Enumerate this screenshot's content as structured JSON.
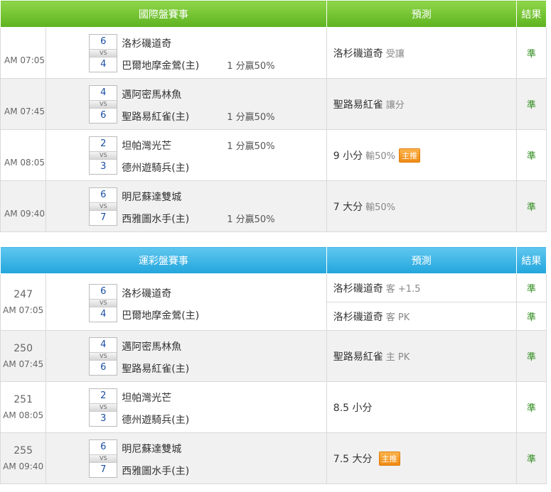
{
  "intl": {
    "header": {
      "match": "國際盤賽事",
      "pred": "預測",
      "res": "結果"
    },
    "rows": [
      {
        "time": "AM 07:05",
        "away": "洛杉磯道奇",
        "away_score": "6",
        "home": "巴爾地摩金鶯(主)",
        "home_score": "4",
        "vs": "VS",
        "pct_home": "1 分贏50%",
        "pct_away": "",
        "pred": "洛杉磯道奇",
        "pred_note": "受讓",
        "badge": "",
        "result": "準"
      },
      {
        "time": "AM 07:45",
        "away": "邁阿密馬林魚",
        "away_score": "4",
        "home": "聖路易紅雀(主)",
        "home_score": "6",
        "vs": "VS",
        "pct_home": "1 分贏50%",
        "pct_away": "",
        "pred": "聖路易紅雀",
        "pred_note": "讓分",
        "badge": "",
        "result": "準"
      },
      {
        "time": "AM 08:05",
        "away": "坦帕灣光芒",
        "away_score": "2",
        "home": "德州遊騎兵(主)",
        "home_score": "3",
        "vs": "VS",
        "pct_home": "",
        "pct_away": "1 分贏50%",
        "pred": "9 小分",
        "pred_note": "輸50%",
        "badge": "主推",
        "result": "準"
      },
      {
        "time": "AM 09:40",
        "away": "明尼蘇達雙城",
        "away_score": "6",
        "home": "西雅圖水手(主)",
        "home_score": "7",
        "vs": "VS",
        "pct_home": "1 分贏50%",
        "pct_away": "",
        "pred": "7 大分",
        "pred_note": "輸50%",
        "badge": "",
        "result": "準"
      }
    ]
  },
  "lottery": {
    "header": {
      "match": "運彩盤賽事",
      "pred": "預測",
      "res": "結果"
    },
    "rows": [
      {
        "num": "247",
        "time": "AM 07:05",
        "away": "洛杉磯道奇",
        "away_score": "6",
        "home": "巴爾地摩金鶯(主)",
        "home_score": "4",
        "vs": "VS",
        "preds": [
          {
            "pred": "洛杉磯道奇",
            "note": "客 +1.5",
            "badge": "",
            "result": "準"
          },
          {
            "pred": "洛杉磯道奇",
            "note": "客 PK",
            "badge": "",
            "result": "準"
          }
        ]
      },
      {
        "num": "250",
        "time": "AM 07:45",
        "away": "邁阿密馬林魚",
        "away_score": "4",
        "home": "聖路易紅雀(主)",
        "home_score": "6",
        "vs": "VS",
        "preds": [
          {
            "pred": "聖路易紅雀",
            "note": "主 PK",
            "badge": "",
            "result": "準"
          }
        ]
      },
      {
        "num": "251",
        "time": "AM 08:05",
        "away": "坦帕灣光芒",
        "away_score": "2",
        "home": "德州遊騎兵(主)",
        "home_score": "3",
        "vs": "VS",
        "preds": [
          {
            "pred": "8.5 小分",
            "note": "",
            "badge": "",
            "result": "準"
          }
        ]
      },
      {
        "num": "255",
        "time": "AM 09:40",
        "away": "明尼蘇達雙城",
        "away_score": "6",
        "home": "西雅圖水手(主)",
        "home_score": "7",
        "vs": "VS",
        "preds": [
          {
            "pred": "7.5 大分",
            "note": "",
            "badge": "主推",
            "result": "準"
          }
        ]
      }
    ]
  }
}
